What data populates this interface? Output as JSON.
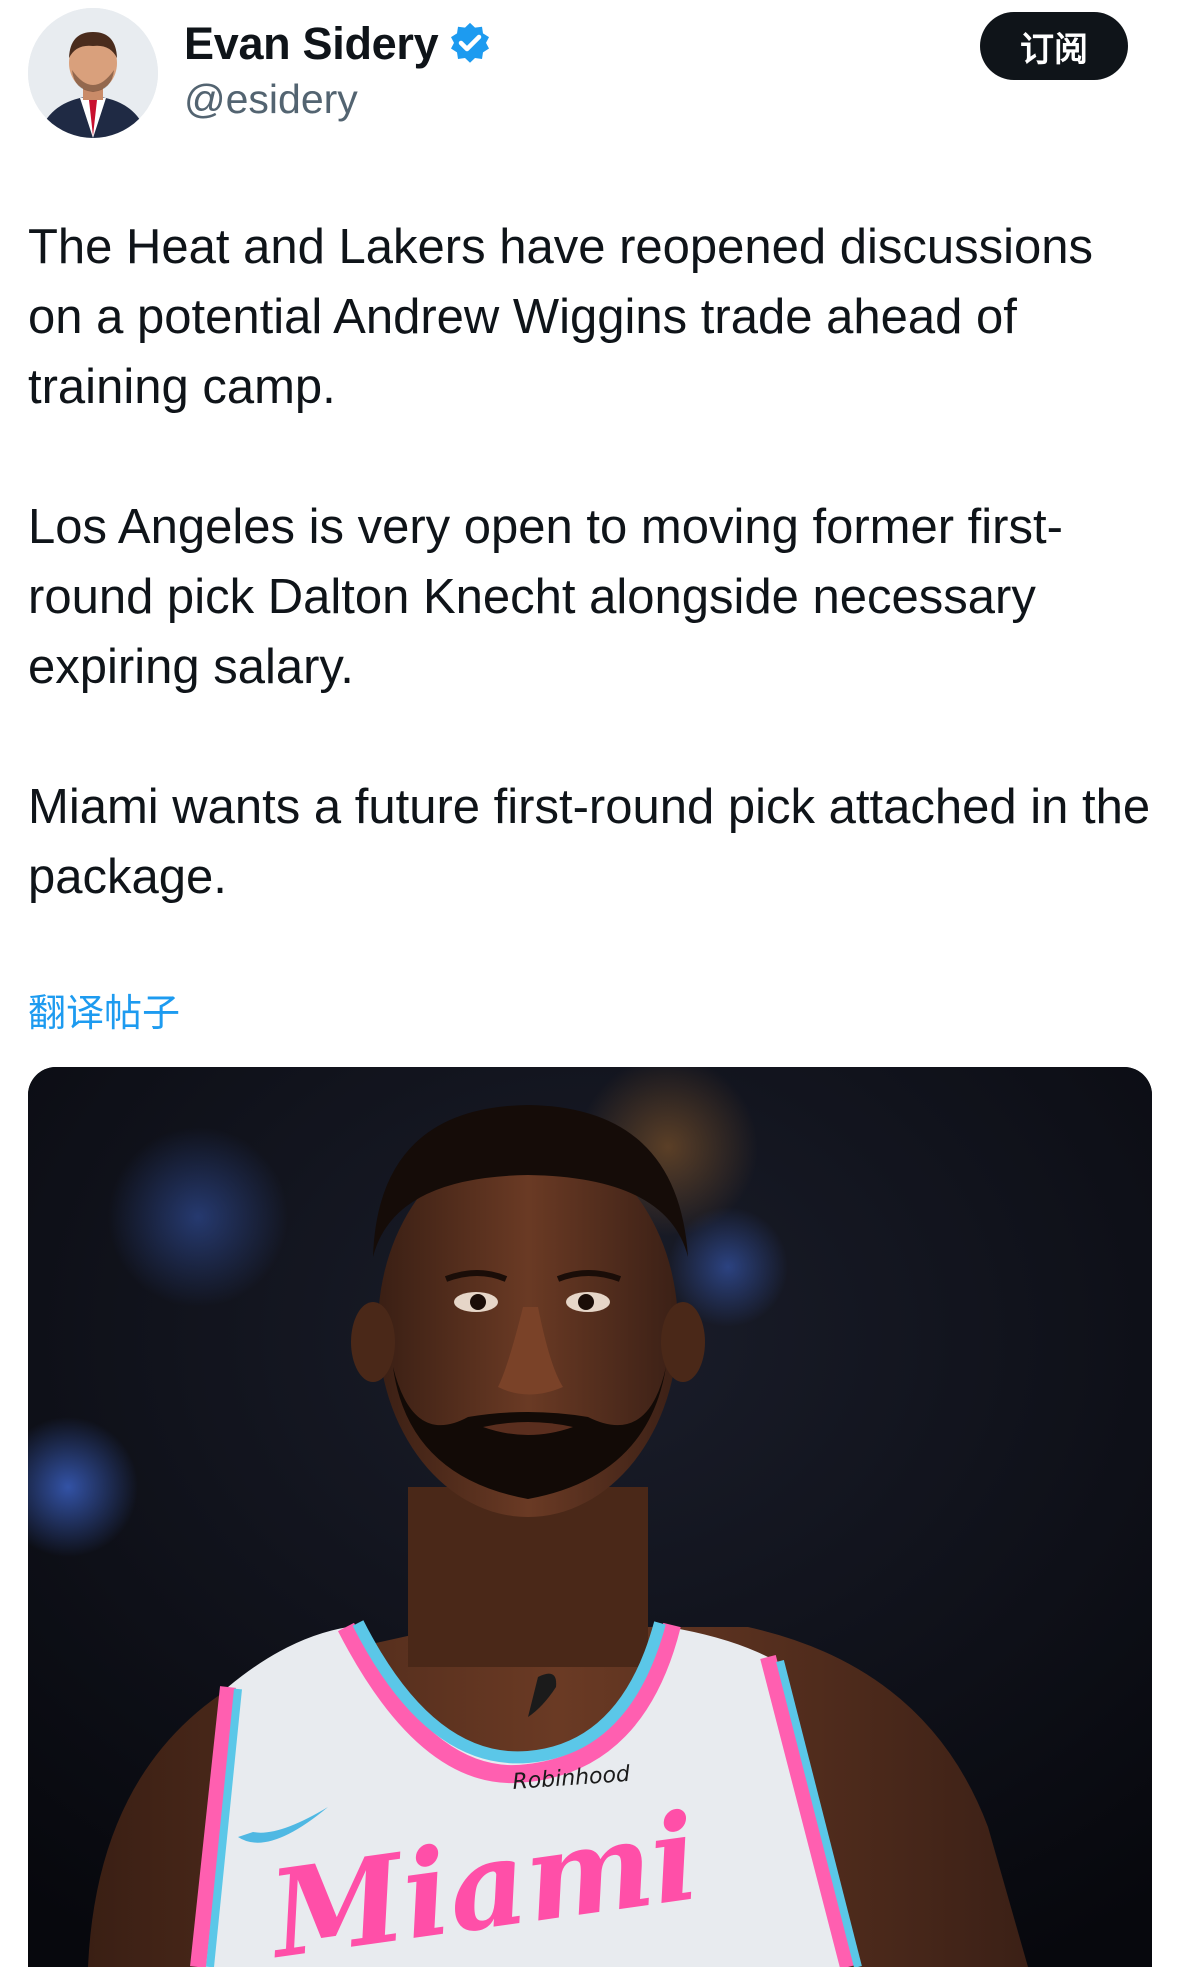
{
  "author": {
    "display_name": "Evan Sidery",
    "handle": "@esidery",
    "verified": true,
    "avatar_icon": "person-avatar",
    "verified_icon": "verified-badge-icon"
  },
  "actions": {
    "subscribe_label": "订阅"
  },
  "tweet": {
    "paragraphs": [
      "The Heat and Lakers have reopened discussions on a potential Andrew Wiggins trade ahead of training camp.",
      "Los Angeles is very open to moving former first-round pick Dalton Knecht alongside necessary expiring salary.",
      "Miami wants a future first-round pick attached in the package."
    ],
    "translate_label": "翻译帖子"
  },
  "media": {
    "jersey_sponsor": "Robinhood",
    "jersey_script": "Miami"
  },
  "colors": {
    "link_blue": "#1d9bf0",
    "text_primary": "#0f1419",
    "text_secondary": "#536471",
    "button_dark": "#0f1419"
  }
}
